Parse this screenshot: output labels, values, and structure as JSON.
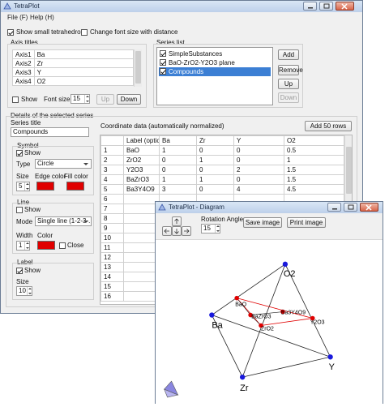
{
  "main": {
    "title": "TetraPlot",
    "menu": [
      "File (F)",
      "Help (H)"
    ],
    "show_small_tetrahedron": "Show small tetrahedron",
    "change_font_size": "Change font size with distance",
    "axis_titles": {
      "label": "Axis titles",
      "rows": [
        {
          "axis": "Axis1",
          "value": "Ba"
        },
        {
          "axis": "Axis2",
          "value": "Zr"
        },
        {
          "axis": "Axis3",
          "value": "Y"
        },
        {
          "axis": "Axis4",
          "value": "O2"
        }
      ],
      "show_label": "Show",
      "font_size_label": "Font size",
      "font_size_value": "15",
      "up_label": "Up",
      "down_label": "Down"
    },
    "series_list": {
      "label": "Series list",
      "items": [
        "SimpleSubstances",
        "BaO-ZrO2-Y2O3 plane",
        "Compounds"
      ],
      "add_label": "Add",
      "remove_label": "Remove",
      "up_label": "Up",
      "down_label": "Down"
    },
    "details": {
      "label": "Details of the selected series",
      "series_title_label": "Series title",
      "series_title_value": "Compounds",
      "symbol": {
        "label": "Symbol",
        "show": "Show",
        "type_label": "Type",
        "type_value": "Circle",
        "size_label": "Size",
        "size_value": "5",
        "edge_color_label": "Edge color",
        "fill_color_label": "Fill color"
      },
      "line": {
        "label": "Line",
        "show": "Show",
        "mode_label": "Mode",
        "mode_value": "Single line (1-2-3-...",
        "width_label": "Width",
        "width_value": "1",
        "color_label": "Color",
        "close_label": "Close"
      },
      "label_group": {
        "label": "Label",
        "show": "Show",
        "size_label": "Size",
        "size_value": "10"
      }
    },
    "coordinates": {
      "label": "Coordinate data (automatically normalized)",
      "add_rows": "Add 50 rows",
      "headers": [
        "",
        "Label (optional)",
        "Ba",
        "Zr",
        "Y",
        "O2"
      ],
      "rows": [
        [
          "1",
          "BaO",
          "1",
          "0",
          "0",
          "0.5"
        ],
        [
          "2",
          "ZrO2",
          "0",
          "1",
          "0",
          "1"
        ],
        [
          "3",
          "Y2O3",
          "0",
          "0",
          "2",
          "1.5"
        ],
        [
          "4",
          "BaZrO3",
          "1",
          "1",
          "0",
          "1.5"
        ],
        [
          "5",
          "Ba3Y4O9",
          "3",
          "0",
          "4",
          "4.5"
        ],
        [
          "6",
          "",
          "",
          "",
          "",
          ""
        ],
        [
          "7",
          "",
          "",
          "",
          "",
          ""
        ],
        [
          "8",
          "",
          "",
          "",
          "",
          ""
        ],
        [
          "9",
          "",
          "",
          "",
          "",
          ""
        ],
        [
          "10",
          "",
          "",
          "",
          "",
          ""
        ],
        [
          "11",
          "",
          "",
          "",
          "",
          ""
        ],
        [
          "12",
          "",
          "",
          "",
          "",
          ""
        ],
        [
          "13",
          "",
          "",
          "",
          "",
          ""
        ],
        [
          "14",
          "",
          "",
          "",
          "",
          ""
        ],
        [
          "15",
          "",
          "",
          "",
          "",
          ""
        ],
        [
          "16",
          "",
          "",
          "",
          "",
          ""
        ]
      ]
    }
  },
  "diagram": {
    "title": "TetraPlot - Diagram",
    "rotation_angle_label": "Rotation Angle",
    "rotation_angle_value": "15",
    "save_image": "Save image",
    "print_image": "Print image",
    "labels": {
      "O2": "O2",
      "Ba": "Ba",
      "Zr": "Zr",
      "Y": "Y",
      "BaO": "BaO",
      "BaZrO3": "BaZrO3",
      "ZrO2": "ZrO2",
      "Ba3Y4O9": "Ba3Y4O9",
      "Y2O3": "Y2O3"
    },
    "colors": {
      "vertex": "#1a1adc",
      "compound": "#e00000",
      "edge": "#222222"
    }
  }
}
